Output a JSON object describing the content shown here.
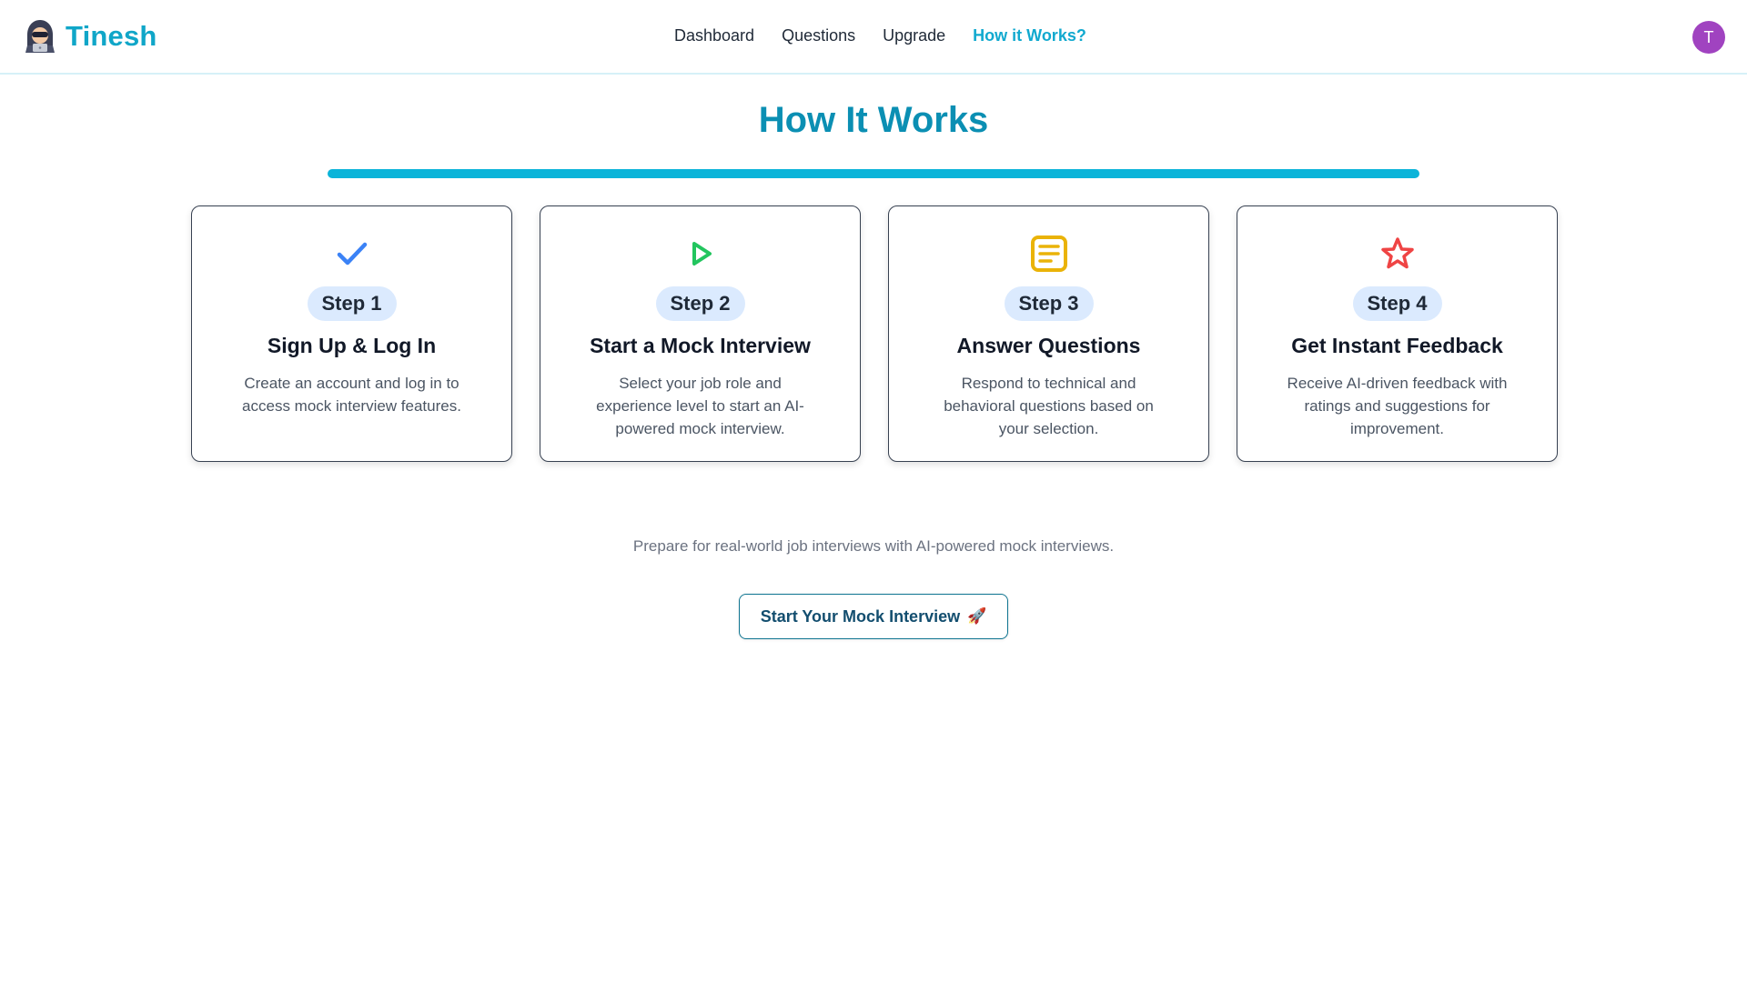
{
  "brand": {
    "name": "Tinesh",
    "logo_icon": "hooded-hacker-icon",
    "color": "#10a6c8"
  },
  "nav": {
    "items": [
      {
        "label": "Dashboard",
        "active": false
      },
      {
        "label": "Questions",
        "active": false
      },
      {
        "label": "Upgrade",
        "active": false
      },
      {
        "label": "How it Works?",
        "active": true
      }
    ],
    "active_color": "#11a9cf"
  },
  "user": {
    "avatar_initial": "T",
    "avatar_color": "#a043c0"
  },
  "main": {
    "title": "How It Works",
    "title_color": "#0b8fb3",
    "accent_color": "#0bb4d9",
    "steps": [
      {
        "step": "Step 1",
        "title": "Sign Up & Log In",
        "description": "Create an account and log in to access mock interview features.",
        "icon": "check-icon",
        "icon_color": "#3b82f6"
      },
      {
        "step": "Step 2",
        "title": "Start a Mock Interview",
        "description": "Select your job role and experience level to start an AI-powered mock interview.",
        "icon": "play-icon",
        "icon_color": "#22c55e"
      },
      {
        "step": "Step 3",
        "title": "Answer Questions",
        "description": "Respond to technical and behavioral questions based on your selection.",
        "icon": "document-text-icon",
        "icon_color": "#eab308"
      },
      {
        "step": "Step 4",
        "title": "Get Instant Feedback",
        "description": "Receive AI-driven feedback with ratings and suggestions for improvement.",
        "icon": "star-icon",
        "icon_color": "#ef4444"
      }
    ],
    "tagline": "Prepare for real-world job interviews with AI-powered mock interviews.",
    "cta": {
      "label": "Start Your Mock Interview",
      "icon": "rocket-icon",
      "icon_glyph": "🚀"
    }
  }
}
